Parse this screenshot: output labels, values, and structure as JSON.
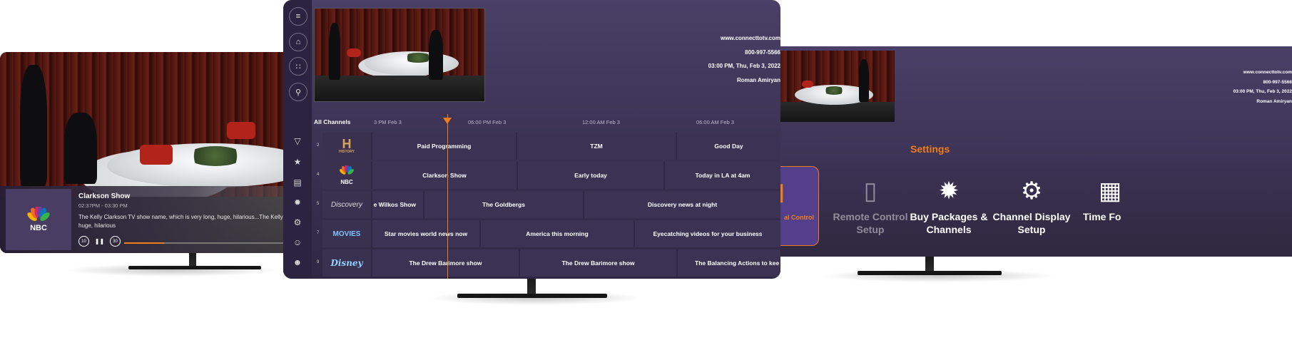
{
  "left_tv": {
    "channel_logo": "NBC",
    "show_title": "Clarkson Show",
    "show_time": "02:37PM - 03:30 PM",
    "description": "The Kelly Clarkson TV show name, which is very long, huge, hilarious...The Kelly very long, huge, hilarious",
    "controls": {
      "rewind": "10",
      "pause": "❚❚",
      "forward": "30"
    },
    "progress": 0.21
  },
  "center_tv": {
    "sidebar": [
      "menu-icon",
      "home-icon",
      "grid-icon",
      "search-icon",
      "filter-icon",
      "star-icon",
      "guide-icon",
      "network-icon",
      "settings-icon",
      "person-icon",
      "robot-icon"
    ],
    "info": {
      "website": "www.connecttotv.com",
      "phone": "800-997-5566",
      "datetime": "03:00 PM, Thu, Feb 3, 2022",
      "user": "Roman Amiryan"
    },
    "timeline": {
      "all_channels": "All Channels",
      "ticks": [
        "3 PM Feb 3",
        "06:00 PM Feb 3",
        "12:00 AM Feb 3",
        "06:00 AM Feb 3"
      ]
    },
    "rows": [
      {
        "num": "2",
        "logo": "HISTORY",
        "programs": [
          "Paid Programming",
          "TZM",
          "Good Day"
        ]
      },
      {
        "num": "4",
        "logo": "NBC",
        "programs": [
          "Clarkson Show",
          "Early today",
          "Today in LA at 4am"
        ]
      },
      {
        "num": "5",
        "logo": "Discovery",
        "programs": [
          "e Wilkos Show",
          "The Goldbergs",
          "Discovery news at night"
        ]
      },
      {
        "num": "7",
        "logo": "MOVIES",
        "programs": [
          "Star movies world news now",
          "America this morning",
          "Eyecatching videos for your business"
        ]
      },
      {
        "num": "9",
        "logo": "Disney",
        "programs": [
          "The Drew Barimore show",
          "The Drew Barimore show",
          "The Balancing Actions to kee"
        ]
      }
    ]
  },
  "right_tv": {
    "info": {
      "website": "www.connecttotv.com",
      "phone": "800-997-5566",
      "datetime": "03:00 PM, Thu, Feb 3, 2022",
      "user": "Roman Amiryan"
    },
    "settings_title": "Settings",
    "tiles": [
      {
        "label": "al Control",
        "icon": "lock-icon"
      },
      {
        "label": "Remote Control Setup",
        "icon": "remote-icon"
      },
      {
        "label": "Buy Packages & Channels",
        "icon": "network-icon"
      },
      {
        "label": "Channel Display Setup",
        "icon": "gear-icon"
      },
      {
        "label": "Time Fo",
        "icon": "calendar-icon"
      }
    ]
  },
  "colors": {
    "accent": "#f07d1a",
    "panel": "#3b3254",
    "background": "#4a3f66"
  }
}
